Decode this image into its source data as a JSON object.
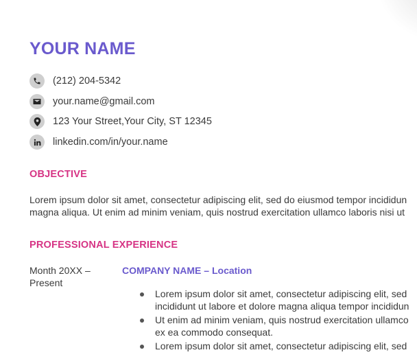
{
  "header": {
    "name": "YOUR NAME"
  },
  "contact": [
    {
      "icon": "phone-icon",
      "text": "(212) 204-5342"
    },
    {
      "icon": "envelope-icon",
      "text": "your.name@gmail.com"
    },
    {
      "icon": "location-pin-icon",
      "text": "123 Your Street,Your City, ST 12345"
    },
    {
      "icon": "linkedin-icon",
      "text": "linkedin.com/in/your.name"
    }
  ],
  "objective": {
    "heading": "OBJECTIVE",
    "lines": [
      "Lorem ipsum dolor sit amet, consectetur adipiscing elit, sed do eiusmod tempor incididun",
      "magna aliqua. Ut enim ad minim veniam, quis nostrud exercitation ullamco laboris nisi ut"
    ]
  },
  "experience": {
    "heading": "PROFESSIONAL EXPERIENCE",
    "entries": [
      {
        "dates": [
          "Month 20XX –",
          "Present"
        ],
        "company": "COMPANY NAME",
        "separator": " – ",
        "location": "Location",
        "bullets": [
          {
            "lines": [
              "Lorem ipsum dolor sit amet, consectetur adipiscing elit, sed",
              "incididunt ut labore et dolore magna aliqua tempor incididun"
            ]
          },
          {
            "lines": [
              "Ut enim ad minim veniam, quis nostrud exercitation ullamco",
              "ex ea commodo consequat."
            ]
          },
          {
            "lines": [
              "Lorem ipsum dolor sit amet, consectetur adipiscing elit, sed"
            ]
          }
        ]
      }
    ]
  },
  "colors": {
    "name": "#6a5acd",
    "section_heading": "#d63384",
    "company": "#6a5acd",
    "body_text": "#3a3a3a",
    "icon_circle": "#cfcfcf"
  }
}
